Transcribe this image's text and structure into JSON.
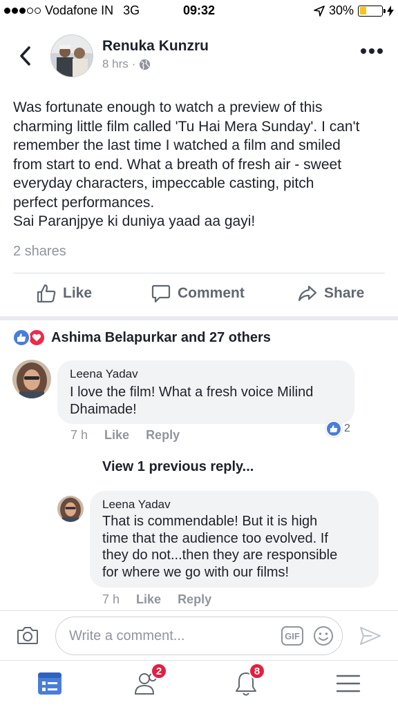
{
  "status_bar": {
    "carrier": "Vodafone IN",
    "network": "3G",
    "time": "09:32",
    "battery": "30%",
    "battery_level": 0.3,
    "signal_bars": 3
  },
  "post": {
    "author": "Renuka Kunzru",
    "time": "8 hrs",
    "visibility_icon": "globe-icon",
    "body_lines": [
      "Was fortunate enough to watch a preview of this",
      "charming little film called 'Tu Hai Mera Sunday'. I can't",
      "remember the last time I watched a film and smiled",
      "from start to end. What a breath of fresh air - sweet",
      "everyday characters, impeccable casting, pitch",
      "perfect performances.",
      "Sai Paranjpye ki duniya yaad aa gayi!"
    ],
    "shares": "2 shares"
  },
  "actions": {
    "like": "Like",
    "comment": "Comment",
    "share": "Share"
  },
  "reactions": {
    "summary": "Ashima Belapurkar and 27 others"
  },
  "comments": [
    {
      "name": "Leena Yadav",
      "text_lines": [
        "I love the film! What a fresh voice Milind",
        "Dhaimade!"
      ],
      "time": "7 h",
      "like": "Like",
      "reply": "Reply",
      "reaction_count": "2"
    }
  ],
  "view_previous": "View 1 previous reply...",
  "reply": {
    "name": "Leena Yadav",
    "text_lines": [
      "That is commendable! But it is high",
      "time that the audience too evolved. If",
      "they do not...then they are responsible",
      "for where we go with our films!"
    ],
    "time": "7 h",
    "like": "Like",
    "reply": "Reply"
  },
  "composer": {
    "placeholder": "Write a comment...",
    "gif_label": "GIF"
  },
  "tabbar": {
    "friends_badge": "2",
    "notifications_badge": "8"
  },
  "colors": {
    "accent": "#4267b2",
    "like_blue": "#4a7dd8",
    "love_red": "#f0284a",
    "badge_red": "#e41e3f",
    "muted": "#90949c"
  }
}
